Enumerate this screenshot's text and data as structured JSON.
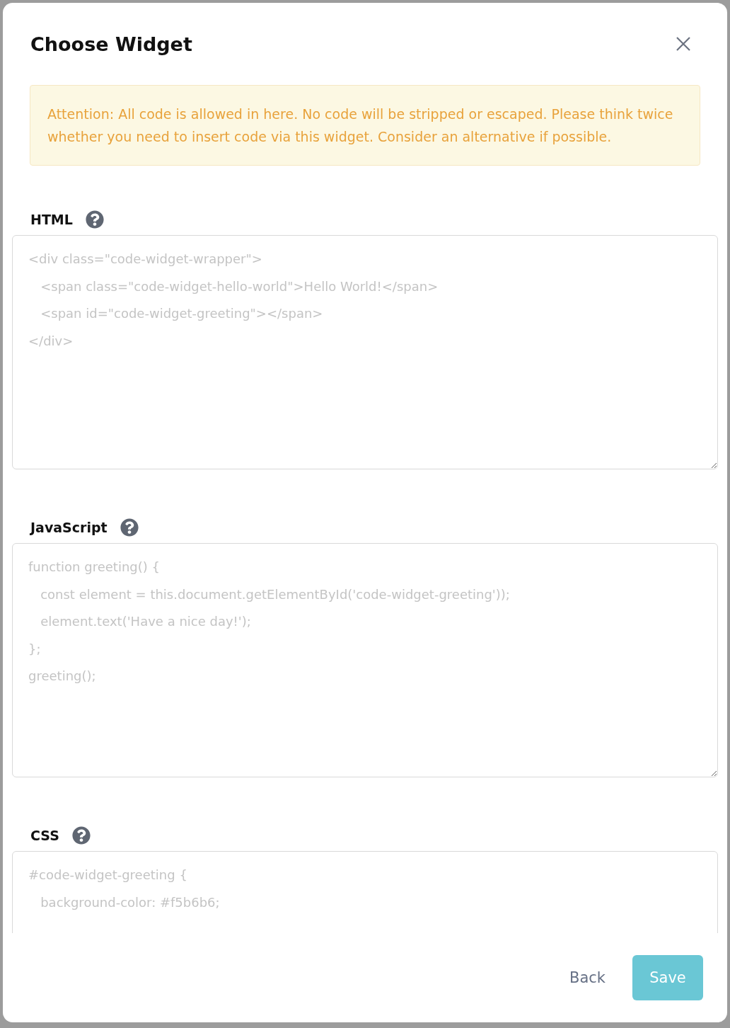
{
  "dialog": {
    "title": "Choose Widget"
  },
  "alert": {
    "text": "Attention: All code is allowed in here. No code will be stripped or escaped. Please think twice whether you need to insert code via this widget. Consider an alternative if possible."
  },
  "fields": [
    {
      "label": "HTML",
      "placeholder": [
        "<div class=\"code-widget-wrapper\">",
        "   <span class=\"code-widget-hello-world\">Hello World!</span>",
        "   <span id=\"code-widget-greeting\"></span>",
        "</div>"
      ]
    },
    {
      "label": "JavaScript",
      "placeholder": [
        "function greeting() {",
        "   const element = this.document.getElementById('code-widget-greeting'));",
        "   element.text('Have a nice day!');",
        "};",
        "greeting();"
      ]
    },
    {
      "label": "CSS",
      "placeholder": [
        "#code-widget-greeting {",
        "   background-color: #f5b6b6;"
      ]
    }
  ],
  "buttons": {
    "back": "Back",
    "save": "Save"
  }
}
